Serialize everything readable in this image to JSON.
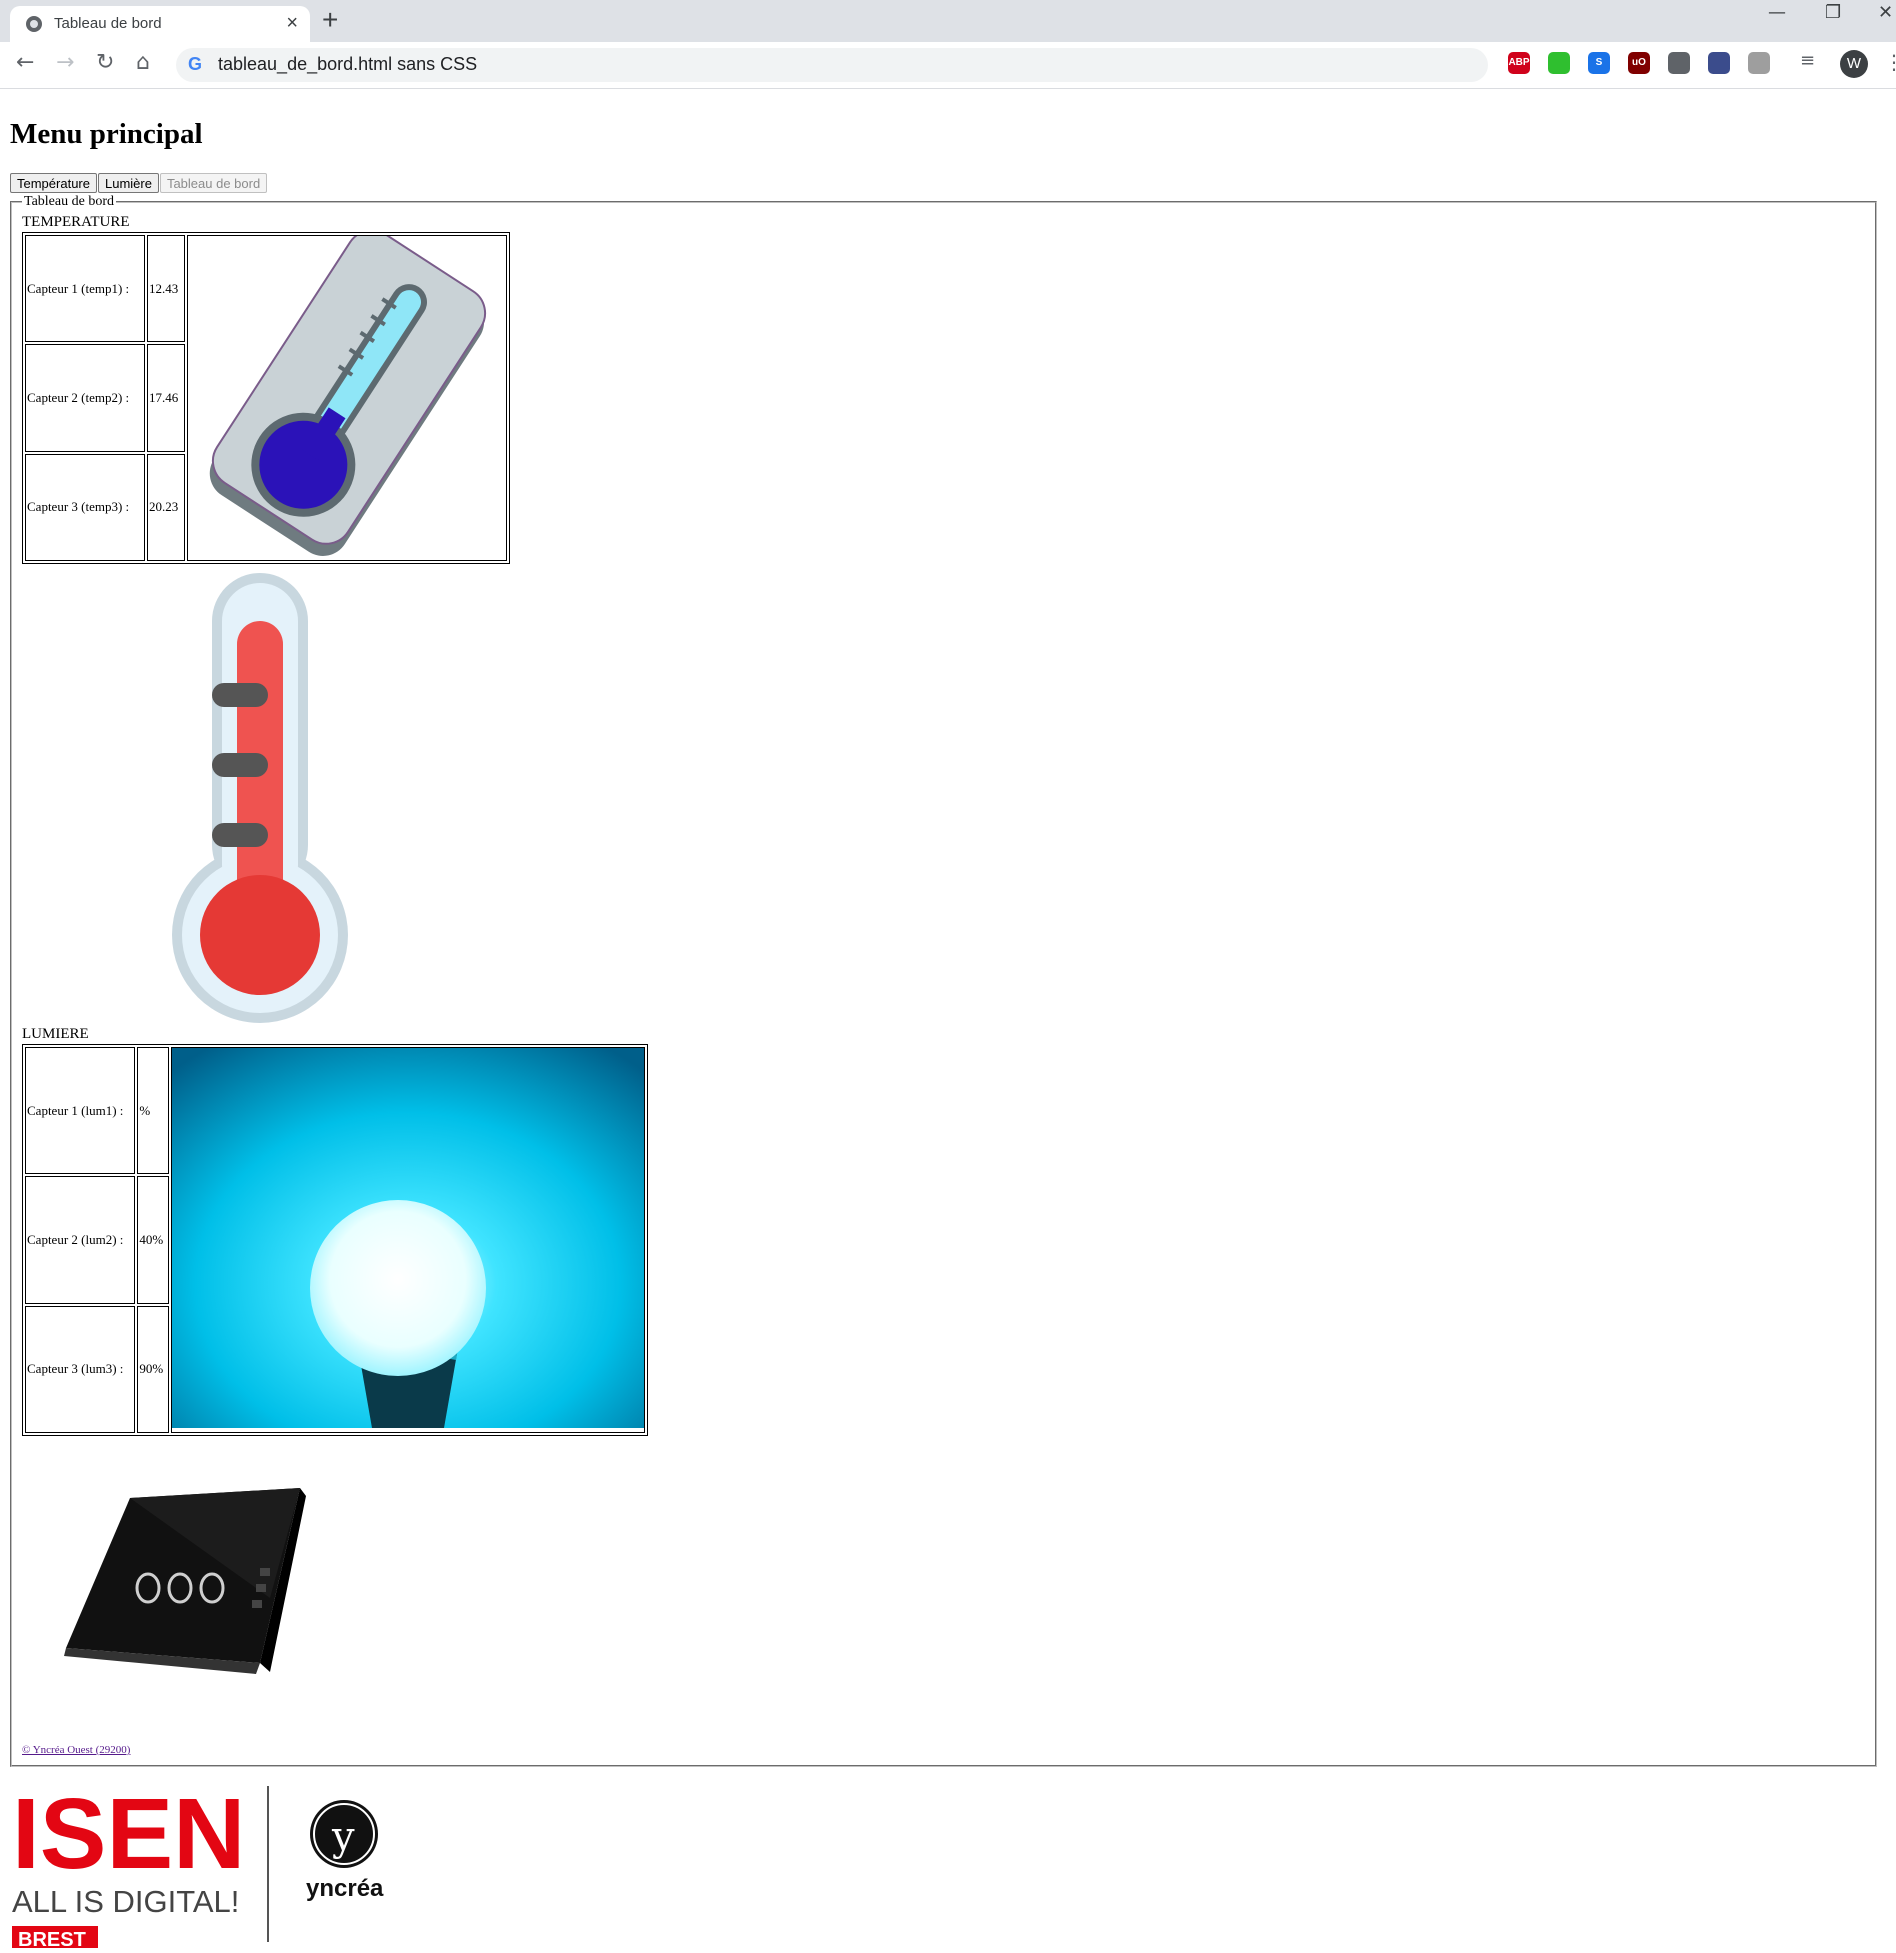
{
  "browser": {
    "tab_title": "Tableau de bord",
    "address": "tableau_de_bord.html sans CSS",
    "avatar_initial": "W",
    "extensions": [
      {
        "name": "adblock-icon",
        "label": "ABP",
        "color": "#d0021b"
      },
      {
        "name": "green-extension-icon",
        "label": "",
        "color": "#2fbf2f"
      },
      {
        "name": "s-extension-icon",
        "label": "S",
        "color": "#1a73e8"
      },
      {
        "name": "ublock-icon",
        "label": "uO",
        "color": "#800000"
      },
      {
        "name": "circle-extension-icon",
        "label": "",
        "color": "#5f6368"
      },
      {
        "name": "lock-extension-icon",
        "label": "",
        "color": "#3b4c8c"
      },
      {
        "name": "pdf-extension-icon",
        "label": "",
        "color": "#9e9e9e"
      }
    ]
  },
  "page": {
    "heading": "Menu principal",
    "menu_buttons": [
      "Température",
      "Lumière",
      "Tableau de bord"
    ],
    "fieldset_legend": "Tableau de bord",
    "temperature": {
      "label": "TEMPERATURE",
      "rows": [
        {
          "label": "Capteur 1 (temp1) :",
          "value": "12.43"
        },
        {
          "label": "Capteur 2 (temp2) :",
          "value": "17.46"
        },
        {
          "label": "Capteur 3 (temp3) :",
          "value": "20.23"
        }
      ]
    },
    "lumiere": {
      "label": "LUMIERE",
      "rows": [
        {
          "label": "Capteur 1 (lum1) :",
          "value": "%"
        },
        {
          "label": "Capteur 2 (lum2) :",
          "value": "40%"
        },
        {
          "label": "Capteur 3 (lum3) :",
          "value": "90%"
        }
      ]
    },
    "footer_link": "© Yncréa Ouest (29200)",
    "logo": {
      "isen": "ISEN",
      "tagline": "ALL IS DIGITAL!",
      "city": "BREST",
      "yncrea": "yncréa"
    }
  },
  "colors": {
    "isen_red": "#e30613",
    "bulb_bg": "#00bfe8"
  }
}
